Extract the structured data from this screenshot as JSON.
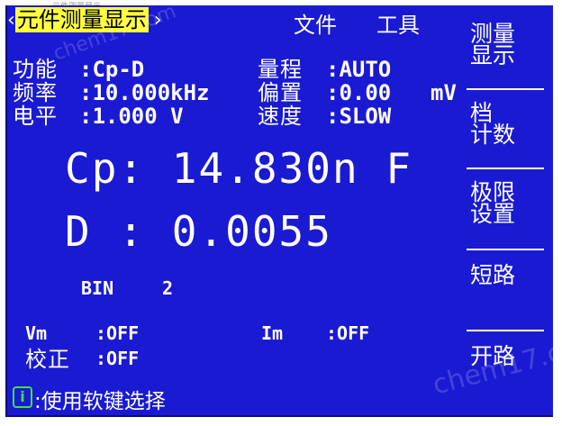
{
  "top_caption": "ーー元件测量显示",
  "header": {
    "left_arrow": "‹",
    "title": "元件测量显示",
    "right_arrow": "›",
    "menu_file": "文件",
    "menu_tools": "工具"
  },
  "params": {
    "function_label": "功能",
    "function_value": ":Cp-D",
    "freq_label": "频率",
    "freq_value": ":10.000kHz",
    "level_label": "电平",
    "level_value": ":1.000 V",
    "range_label": "量程",
    "range_value": ":AUTO",
    "bias_label": "偏置",
    "bias_value": ":0.00",
    "bias_unit": "mV",
    "speed_label": "速度",
    "speed_value": ":SLOW"
  },
  "readings": {
    "primary": "Cp: 14.830n F",
    "secondary": "D : 0.0055",
    "bin_label": "BIN",
    "bin_value": "2"
  },
  "monitors": {
    "vm_label": "Vm",
    "vm_value": ":OFF",
    "im_label": "Im",
    "im_value": ":OFF",
    "correction_label": "校正",
    "correction_value": ":OFF"
  },
  "softkeys": [
    {
      "line1": "测量",
      "line2": "显示"
    },
    {
      "line1": "档",
      "line2": "计数"
    },
    {
      "line1": "极限",
      "line2": "设置"
    },
    {
      "line1": "短路",
      "line2": ""
    },
    {
      "line1": "开路",
      "line2": ""
    }
  ],
  "hint": {
    "icon": "i",
    "text": ":使用软键选择"
  },
  "watermark": "chem17.com",
  "colors": {
    "screen_bg": "#1a1ad2",
    "title_highlight": "#ffff40",
    "hint_icon": "#40e040"
  }
}
